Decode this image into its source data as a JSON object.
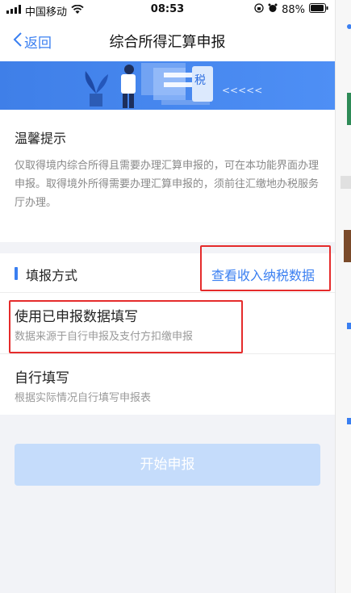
{
  "status": {
    "carrier": "中国移动",
    "time": "08:53",
    "battery": "88%"
  },
  "nav": {
    "back_label": "返回",
    "title": "综合所得汇算申报"
  },
  "banner": {
    "tag": "税",
    "arrows": "<<<<<"
  },
  "tips": {
    "title": "温馨提示",
    "body": "仅取得境内综合所得且需要办理汇算申报的，可在本功能界面办理申报。取得境外所得需要办理汇算申报的，须前往汇缴地办税服务厅办理。"
  },
  "method": {
    "title": "填报方式",
    "link": "查看收入纳税数据",
    "options": [
      {
        "title": "使用已申报数据填写",
        "subtitle": "数据来源于自行申报及支付方扣缴申报"
      },
      {
        "title": "自行填写",
        "subtitle": "根据实际情况自行填写申报表"
      }
    ]
  },
  "start_button": "开始申报",
  "colors": {
    "accent": "#3a7ff1",
    "highlight": "#e52b2b",
    "disabled_button": "#c5dcfb"
  }
}
